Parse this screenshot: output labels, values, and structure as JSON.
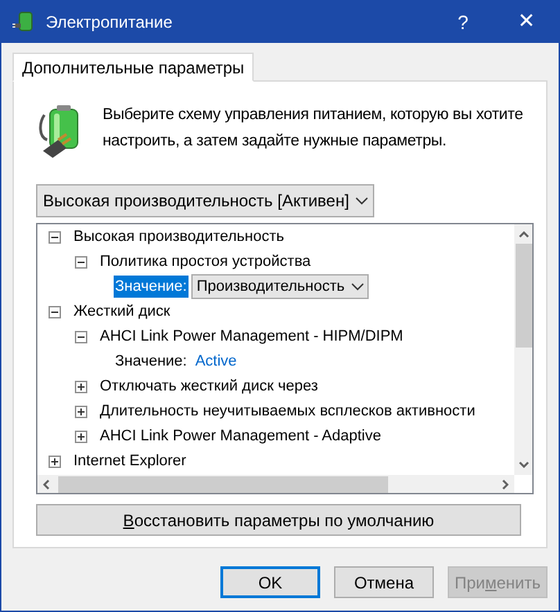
{
  "window": {
    "title": "Электропитание",
    "help": "?",
    "close": "✕"
  },
  "tabs": [
    {
      "label": "Дополнительные параметры",
      "selected": true
    }
  ],
  "description": "Выберите схему управления питанием, которую вы хотите настроить, а затем задайте нужные параметры.",
  "plan_dropdown": {
    "value": "Высокая производительность [Активен]"
  },
  "tree": [
    {
      "label": "Высокая производительность",
      "expanded": true,
      "children": [
        {
          "label": "Политика простоя устройства",
          "expanded": true,
          "children": [
            {
              "kind": "value_select",
              "label": "Значение:",
              "value": "Производительность",
              "selected": true
            }
          ]
        }
      ]
    },
    {
      "label": "Жесткий диск",
      "expanded": true,
      "children": [
        {
          "label": "AHCI Link Power Management - HIPM/DIPM",
          "expanded": true,
          "children": [
            {
              "kind": "value_link",
              "label": "Значение:",
              "value": "Active",
              "selected": false
            }
          ]
        },
        {
          "label": "Отключать жесткий диск через",
          "expanded": false
        },
        {
          "label": "Длительность неучитываемых всплесков активности",
          "expanded": false
        },
        {
          "label": "AHCI Link Power Management - Adaptive",
          "expanded": false
        }
      ]
    },
    {
      "label": "Internet Explorer",
      "expanded": false
    }
  ],
  "restore_button": {
    "mnemonic": "В",
    "after": "осстановить параметры по умолчанию"
  },
  "buttons": [
    {
      "before": "OK",
      "default": true,
      "disabled": false
    },
    {
      "before": "Отмена",
      "default": false,
      "disabled": false
    },
    {
      "before": "При",
      "mnemonic": "м",
      "after": "енить",
      "default": false,
      "disabled": true
    }
  ]
}
